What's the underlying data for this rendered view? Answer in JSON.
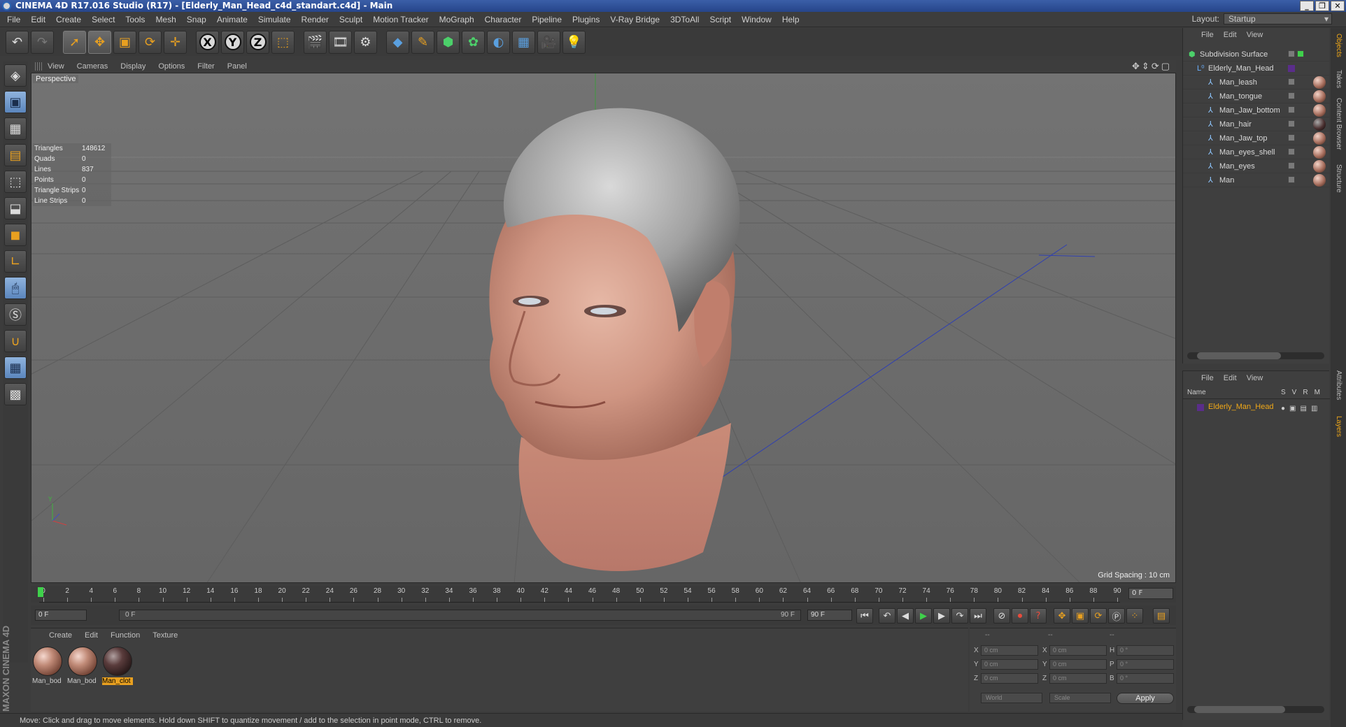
{
  "window": {
    "title": "CINEMA 4D R17.016 Studio (R17) - [Elderly_Man_Head_c4d_standart.c4d] - Main"
  },
  "menu": [
    "File",
    "Edit",
    "Create",
    "Select",
    "Tools",
    "Mesh",
    "Snap",
    "Animate",
    "Simulate",
    "Render",
    "Sculpt",
    "Motion Tracker",
    "MoGraph",
    "Character",
    "Pipeline",
    "Plugins",
    "V-Ray Bridge",
    "3DToAll",
    "Script",
    "Window",
    "Help"
  ],
  "layout": {
    "label": "Layout:",
    "value": "Startup"
  },
  "viewport": {
    "menu": [
      "View",
      "Cameras",
      "Display",
      "Options",
      "Filter",
      "Panel"
    ],
    "camera_label": "Perspective",
    "grid_spacing": "Grid Spacing : 10 cm",
    "stats": [
      {
        "k": "Triangles",
        "v": "148612"
      },
      {
        "k": "Quads",
        "v": "0"
      },
      {
        "k": "Lines",
        "v": "837"
      },
      {
        "k": "Points",
        "v": "0"
      },
      {
        "k": "Triangle Strips",
        "v": "0"
      },
      {
        "k": "Line Strips",
        "v": "0"
      }
    ]
  },
  "timeline": {
    "ticks": [
      "0",
      "2",
      "4",
      "6",
      "8",
      "10",
      "12",
      "14",
      "16",
      "18",
      "20",
      "22",
      "24",
      "26",
      "28",
      "30",
      "32",
      "34",
      "36",
      "38",
      "40",
      "42",
      "44",
      "46",
      "48",
      "50",
      "52",
      "54",
      "56",
      "58",
      "60",
      "62",
      "64",
      "66",
      "68",
      "70",
      "72",
      "74",
      "76",
      "78",
      "80",
      "82",
      "84",
      "86",
      "88",
      "90"
    ],
    "current_frame": "0 F",
    "start": "0 F",
    "range_start": "0 F",
    "range_end": "90 F",
    "end": "90 F"
  },
  "materials": {
    "menu": [
      "Create",
      "Edit",
      "Function",
      "Texture"
    ],
    "items": [
      {
        "label": "Man_bod"
      },
      {
        "label": "Man_bod"
      },
      {
        "label": "Man_clot"
      }
    ]
  },
  "coords": {
    "headers": [
      "--",
      "--",
      "--"
    ],
    "rows": [
      {
        "a": "X",
        "av": "0 cm",
        "b": "X",
        "bv": "0 cm",
        "c": "H",
        "cv": "0 °"
      },
      {
        "a": "Y",
        "av": "0 cm",
        "b": "Y",
        "bv": "0 cm",
        "c": "P",
        "cv": "0 °"
      },
      {
        "a": "Z",
        "av": "0 cm",
        "b": "Z",
        "bv": "0 cm",
        "c": "B",
        "cv": "0 °"
      }
    ],
    "space": "World",
    "mode": "Scale",
    "apply": "Apply"
  },
  "status": "Move: Click and drag to move elements. Hold down SHIFT to quantize movement / add to the selection in point mode, CTRL to remove.",
  "brand": "MAXON CINEMA 4D",
  "objects": {
    "menu": [
      "File",
      "Edit",
      "View"
    ],
    "items": [
      {
        "name": "Subdivision Surface",
        "icon": "subdivision-icon"
      },
      {
        "name": "Elderly_Man_Head",
        "icon": "null-icon"
      },
      {
        "name": "Man_leash",
        "icon": "bone-icon"
      },
      {
        "name": "Man_tongue",
        "icon": "bone-icon"
      },
      {
        "name": "Man_Jaw_bottom",
        "icon": "bone-icon"
      },
      {
        "name": "Man_hair",
        "icon": "bone-icon"
      },
      {
        "name": "Man_Jaw_top",
        "icon": "bone-icon"
      },
      {
        "name": "Man_eyes_shell",
        "icon": "bone-icon"
      },
      {
        "name": "Man_eyes",
        "icon": "bone-icon"
      },
      {
        "name": "Man",
        "icon": "bone-icon"
      }
    ]
  },
  "layers": {
    "menu": [
      "File",
      "Edit",
      "View"
    ],
    "columns": [
      "Name",
      "S",
      "V",
      "R",
      "M"
    ],
    "items": [
      {
        "name": "Elderly_Man_Head"
      }
    ]
  },
  "side_tabs": [
    "Objects",
    "Takes",
    "Content Browser",
    "Structure",
    "Attributes",
    "Layers"
  ]
}
